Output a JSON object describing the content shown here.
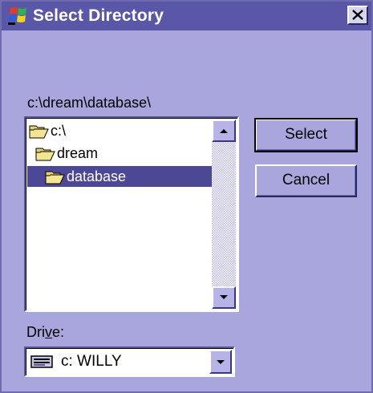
{
  "window": {
    "title": "Select Directory",
    "icon": "windows-flag-icon",
    "close_icon": "close-icon"
  },
  "current_path": "c:\\dream\\database\\",
  "directory_tree": {
    "items": [
      {
        "label": "c:\\",
        "icon": "open-folder-icon",
        "selected": false
      },
      {
        "label": "dream",
        "icon": "open-folder-icon",
        "selected": false
      },
      {
        "label": "database",
        "icon": "open-folder-icon",
        "selected": true
      }
    ]
  },
  "buttons": {
    "select_label": "Select",
    "cancel_label": "Cancel"
  },
  "drive": {
    "label_prefix": "Dri",
    "label_accel": "v",
    "label_suffix": "e:",
    "selected": "c: WILLY",
    "icon": "hard-drive-icon"
  },
  "colors": {
    "dialog_bg": "#a8a6dc",
    "titlebar": "#5a56a8",
    "selection": "#4c4896"
  }
}
